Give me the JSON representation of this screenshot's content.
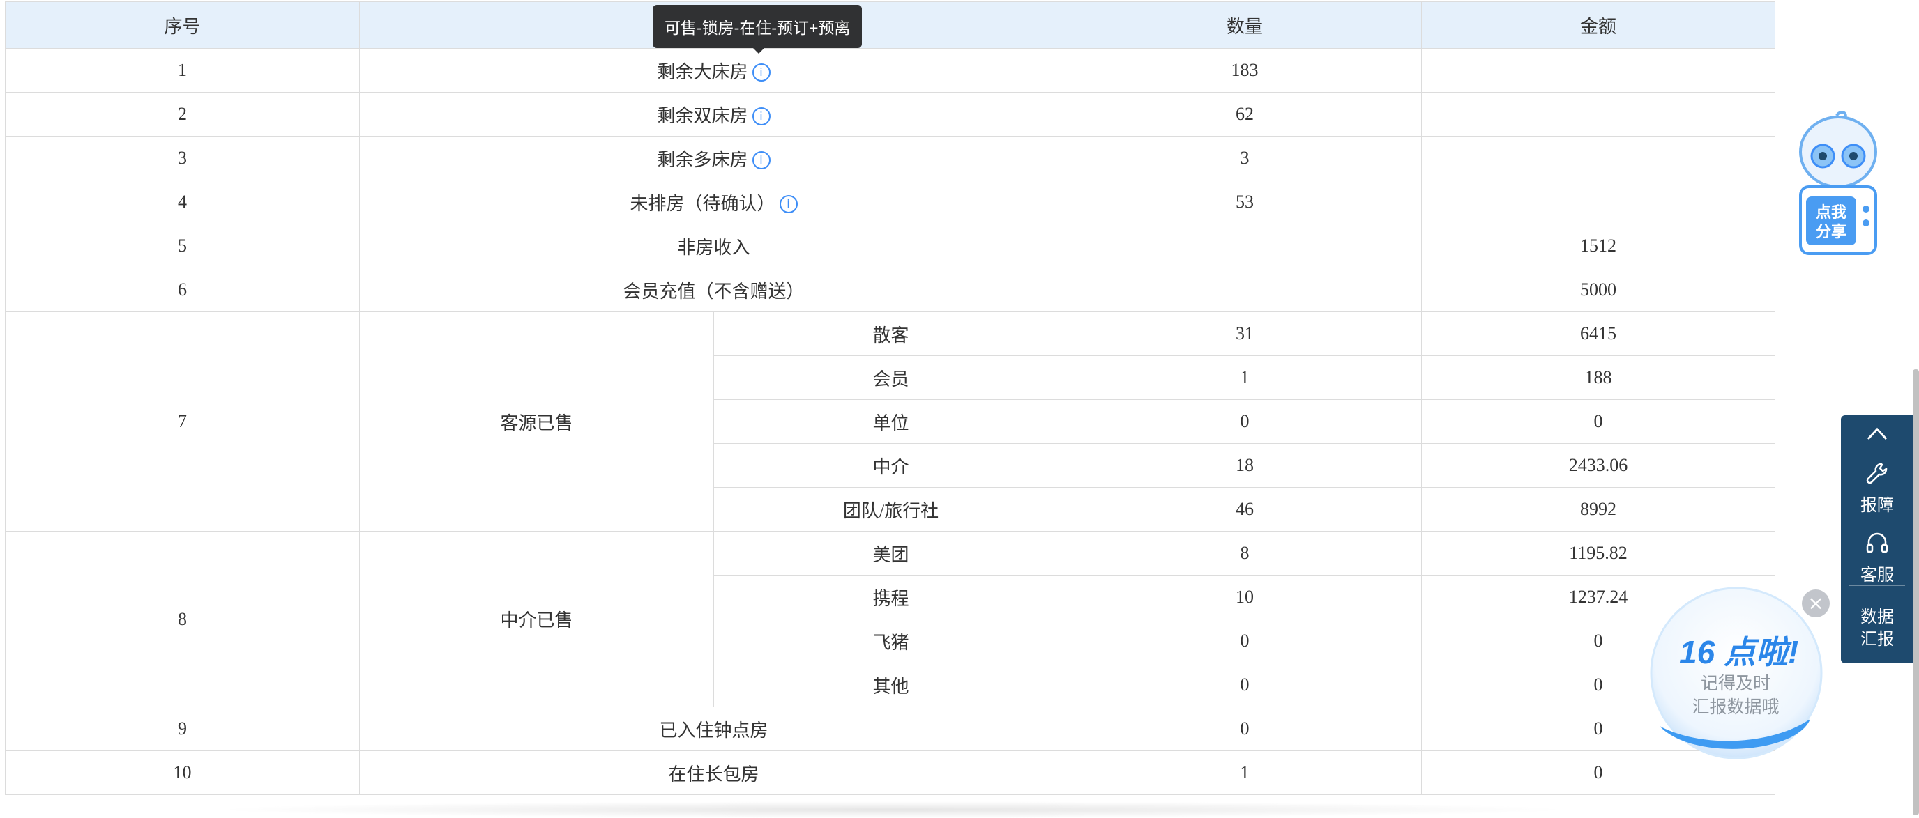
{
  "table": {
    "headers": {
      "index": "序号",
      "item": "",
      "quantity": "数量",
      "amount": "金额"
    },
    "simple_rows_top": [
      {
        "index": "1",
        "label": "剩余大床房",
        "info": true,
        "quantity": "183",
        "amount": ""
      },
      {
        "index": "2",
        "label": "剩余双床房",
        "info": true,
        "quantity": "62",
        "amount": ""
      },
      {
        "index": "3",
        "label": "剩余多床房",
        "info": true,
        "quantity": "3",
        "amount": ""
      },
      {
        "index": "4",
        "label": "未排房（待确认）",
        "info": true,
        "quantity": "53",
        "amount": ""
      },
      {
        "index": "5",
        "label": "非房收入",
        "info": false,
        "quantity": "",
        "amount": "1512"
      },
      {
        "index": "6",
        "label": "会员充值（不含赠送）",
        "info": false,
        "quantity": "",
        "amount": "5000"
      }
    ],
    "group_source": {
      "index": "7",
      "label": "客源已售",
      "rows": [
        {
          "label": "散客",
          "quantity": "31",
          "amount": "6415"
        },
        {
          "label": "会员",
          "quantity": "1",
          "amount": "188"
        },
        {
          "label": "单位",
          "quantity": "0",
          "amount": "0"
        },
        {
          "label": "中介",
          "quantity": "18",
          "amount": "2433.06"
        },
        {
          "label": "团队/旅行社",
          "quantity": "46",
          "amount": "8992"
        }
      ]
    },
    "group_agency": {
      "index": "8",
      "label": "中介已售",
      "rows": [
        {
          "label": "美团",
          "quantity": "8",
          "amount": "1195.82"
        },
        {
          "label": "携程",
          "quantity": "10",
          "amount": "1237.24"
        },
        {
          "label": "飞猪",
          "quantity": "0",
          "amount": "0"
        },
        {
          "label": "其他",
          "quantity": "0",
          "amount": "0"
        }
      ]
    },
    "simple_rows_bottom": [
      {
        "index": "9",
        "label": "已入住钟点房",
        "quantity": "0",
        "amount": "0"
      },
      {
        "index": "10",
        "label": "在住长包房",
        "quantity": "1",
        "amount": "0"
      }
    ]
  },
  "tooltip": {
    "text": "可售-锁房-在住-预订+预离"
  },
  "mascot": {
    "text_line1": "点我",
    "text_line2": "分享"
  },
  "side_panel": {
    "report_label": "报障",
    "service_label": "客服",
    "data_label_line1": "数据",
    "data_label_line2": "汇报"
  },
  "reminder": {
    "title": "16 点啦!",
    "line1": "记得及时",
    "line2": "汇报数据哦"
  },
  "colors": {
    "header_bg": "#e5f0fb",
    "accent": "#3e8ef7",
    "side_panel_bg": "#1e4a6e",
    "tooltip_bg": "#303133"
  }
}
